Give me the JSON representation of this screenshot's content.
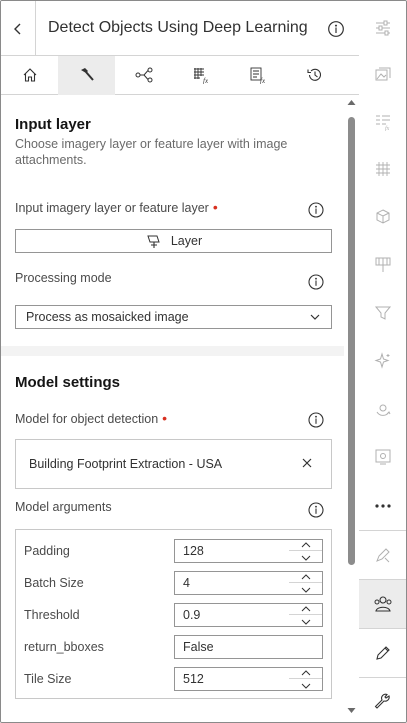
{
  "header": {
    "title": "Detect Objects Using Deep Learning"
  },
  "tabs": [
    {
      "icon": "home-icon"
    },
    {
      "icon": "hammer-icon",
      "active": true
    },
    {
      "icon": "workflow-icon"
    },
    {
      "icon": "raster-function-icon"
    },
    {
      "icon": "table-function-icon"
    },
    {
      "icon": "history-icon"
    }
  ],
  "input_layer": {
    "title": "Input layer",
    "description": "Choose imagery layer or feature layer with image attachments.",
    "imagery_label": "Input imagery layer or feature layer",
    "layer_button": "Layer",
    "processing_label": "Processing mode",
    "processing_value": "Process as mosaicked image"
  },
  "model_settings": {
    "title": "Model settings",
    "model_label": "Model for object detection",
    "model_value": "Building Footprint Extraction - USA",
    "arguments_label": "Model arguments",
    "arguments": [
      {
        "name": "Padding",
        "value": "128"
      },
      {
        "name": "Batch Size",
        "value": "4"
      },
      {
        "name": "Threshold",
        "value": "0.9"
      },
      {
        "name": "return_bboxes",
        "value": "False"
      },
      {
        "name": "Tile Size",
        "value": "512"
      }
    ]
  },
  "colors": {
    "required": "#d83020",
    "icon": "#6a6a6a",
    "icon_light": "#b0b0b0",
    "active_bg": "#ececec"
  },
  "actionbar": [
    "sliders-icon",
    "image-layers-icon",
    "filter-list-icon",
    "grid-icon",
    "cube-icon",
    "brush-grid-icon",
    "funnel-icon",
    "sparkle-icon",
    "camera-rotate-icon",
    "image-settings-icon",
    "more-icon",
    "pencil-ruler-icon",
    "people-detection-icon",
    "edit-icon",
    "wrench-icon"
  ]
}
